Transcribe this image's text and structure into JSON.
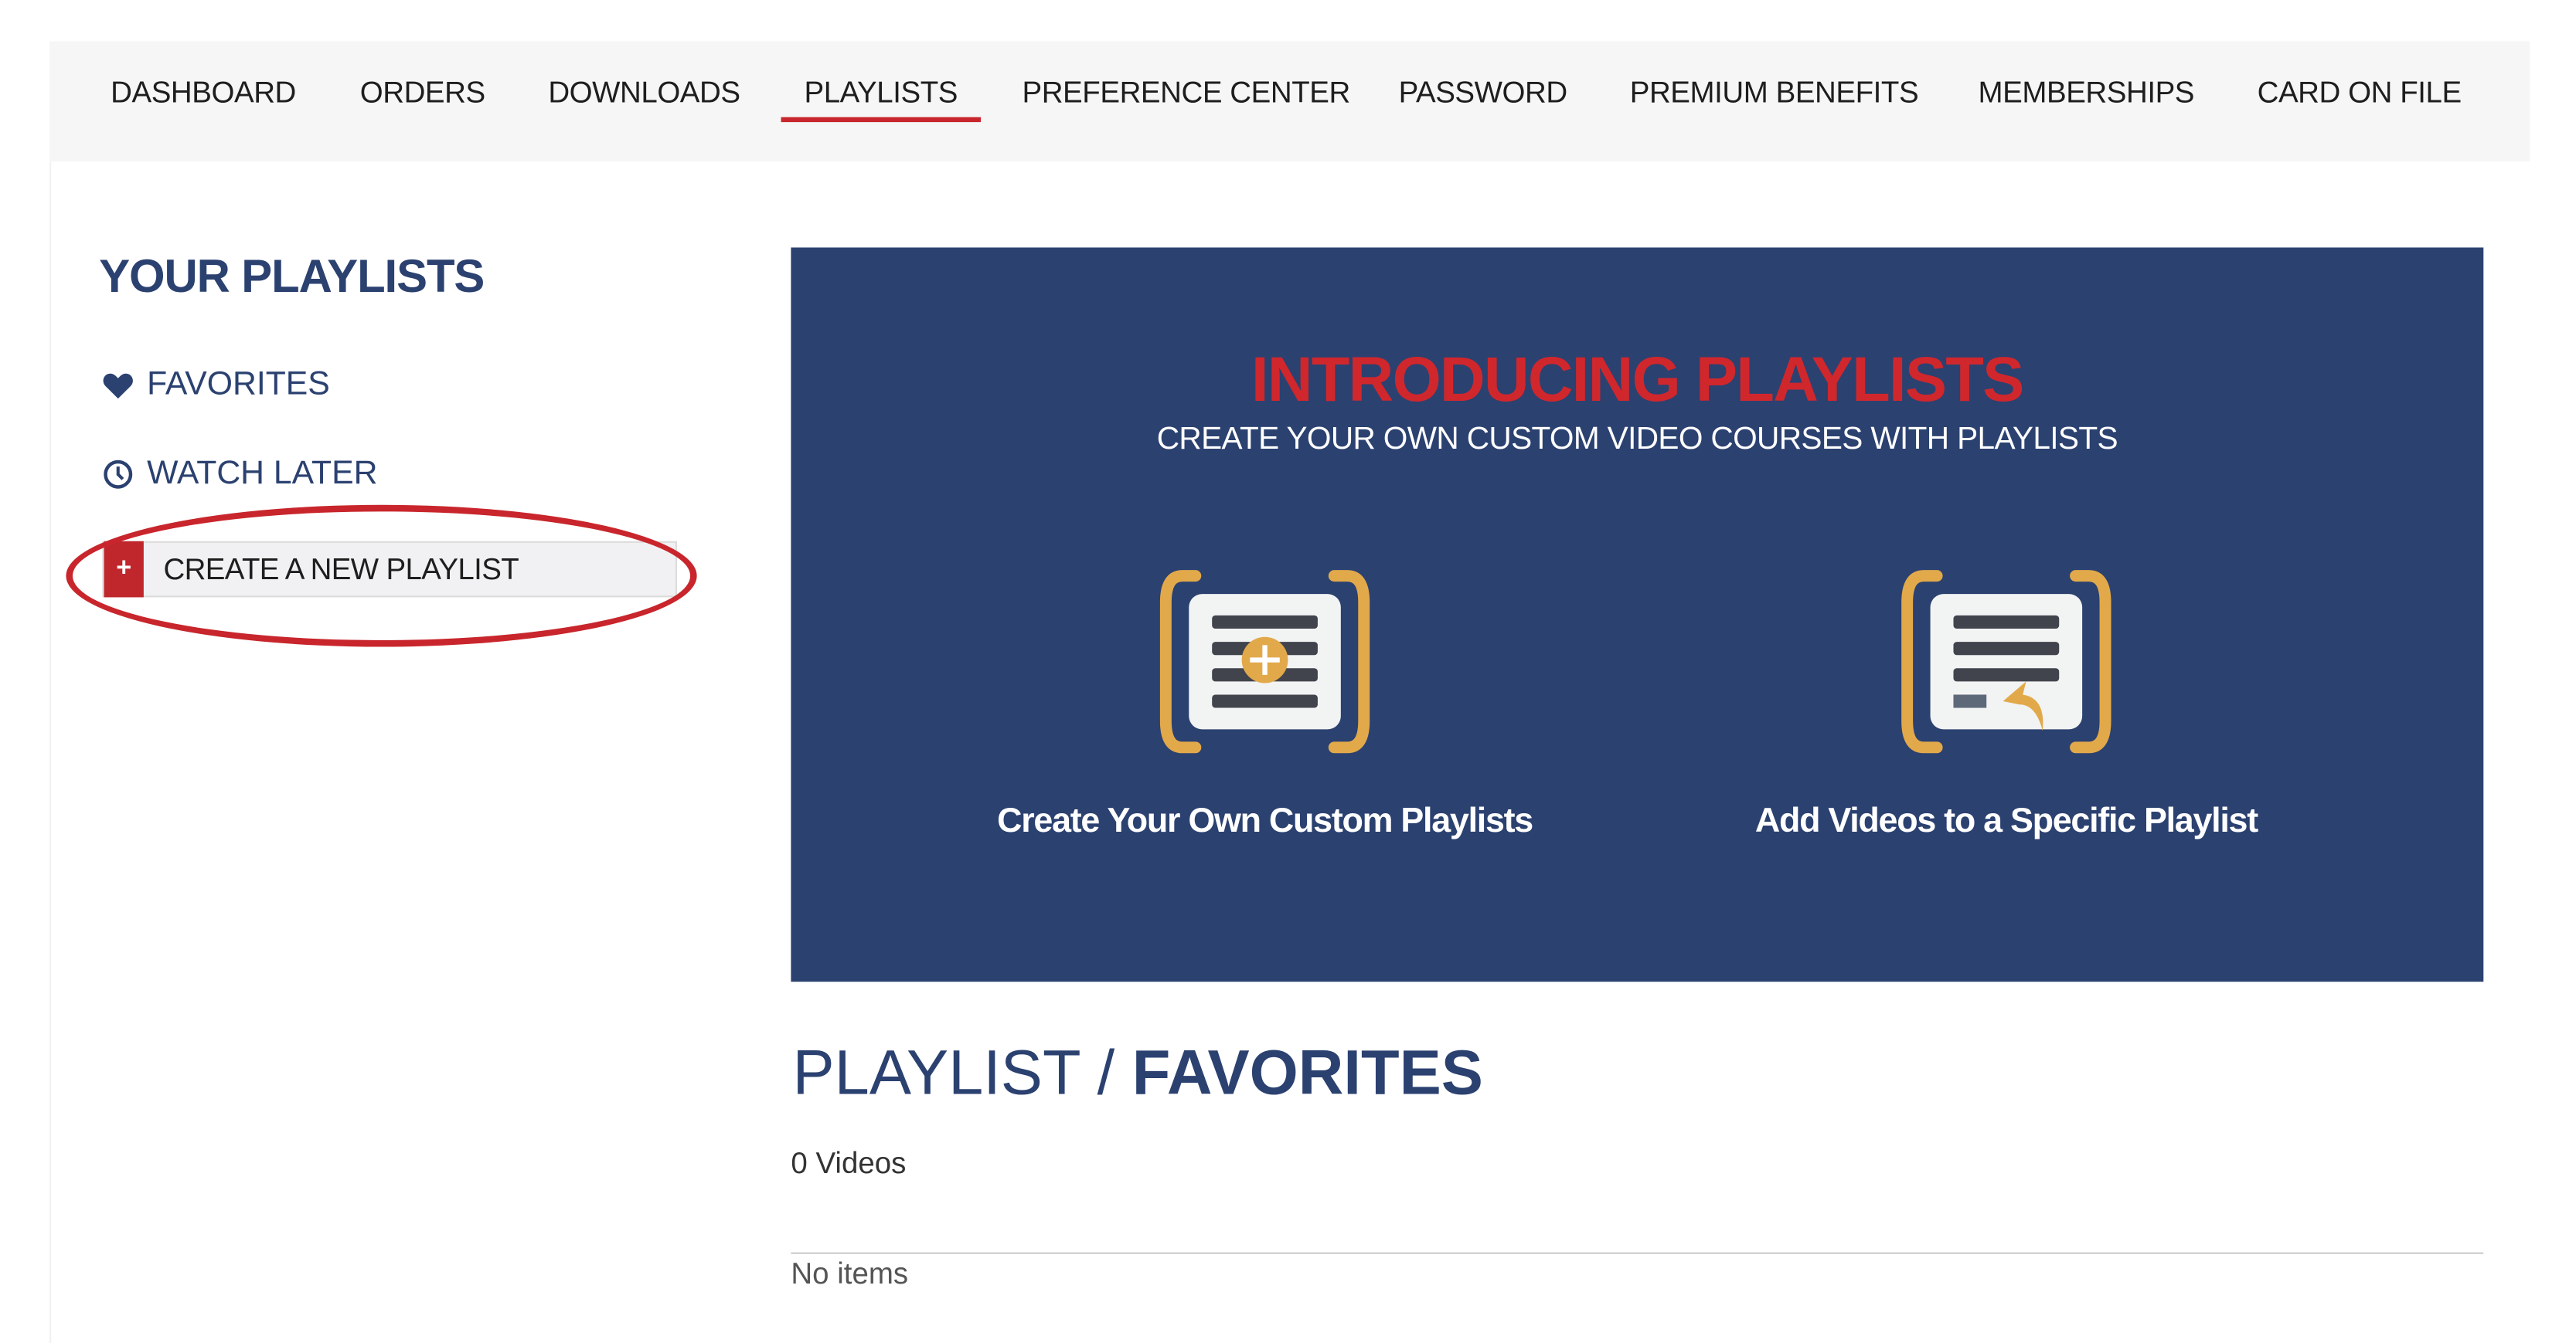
{
  "nav": {
    "items": [
      {
        "label": "DASHBOARD"
      },
      {
        "label": "ORDERS"
      },
      {
        "label": "DOWNLOADS"
      },
      {
        "label": "PLAYLISTS",
        "active": true
      },
      {
        "label": "PREFERENCE CENTER"
      },
      {
        "label": "PASSWORD"
      },
      {
        "label": "PREMIUM BENEFITS"
      },
      {
        "label": "MEMBERSHIPS"
      },
      {
        "label": "CARD ON FILE"
      }
    ]
  },
  "sidebar": {
    "title": "YOUR PLAYLISTS",
    "items": [
      {
        "label": "FAVORITES",
        "icon": "heart-icon"
      },
      {
        "label": "WATCH LATER",
        "icon": "clock-icon"
      }
    ],
    "create_label": "CREATE A NEW PLAYLIST",
    "create_icon": "+"
  },
  "banner": {
    "title": "INTRODUCING PLAYLISTS",
    "subtitle": "CREATE YOUR OWN CUSTOM VIDEO COURSES WITH PLAYLISTS",
    "features": [
      {
        "caption": "Create Your Own Custom Playlists",
        "icon": "playlist-add-icon"
      },
      {
        "caption": "Add Videos to a Specific Playlist",
        "icon": "playlist-insert-icon"
      }
    ]
  },
  "playlist": {
    "prefix": "PLAYLIST / ",
    "name": "FAVORITES",
    "count": "0 Videos",
    "empty": "No items"
  },
  "colors": {
    "navy": "#2b4170",
    "red": "#c8262c",
    "gold": "#e2a94b"
  }
}
